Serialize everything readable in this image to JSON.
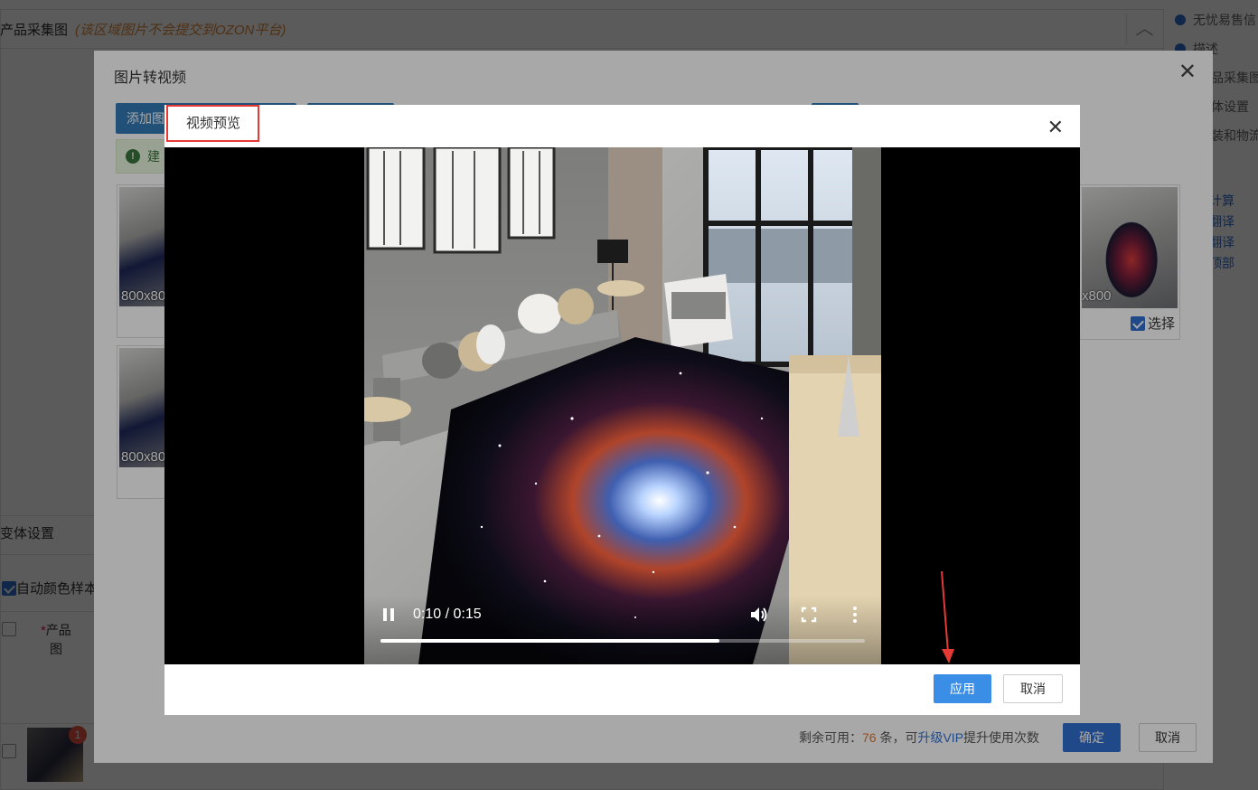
{
  "background": {
    "section_title": "产品采集图",
    "section_note": "(该区域图片不会提交到OZON平台)",
    "right_nav": [
      {
        "label": "无忧易售信",
        "active": true
      },
      {
        "label": "描述",
        "active": true
      },
      {
        "label": "品采集图",
        "active": false
      },
      {
        "label": "体设置",
        "active": false
      },
      {
        "label": "装和物流",
        "active": false
      }
    ],
    "right_links": [
      "计算",
      "翻译",
      "翻译",
      "顶部"
    ],
    "variants_title": "变体设置",
    "auto_color_label": "自动颜色样本",
    "product_image_col": "产品图",
    "row_badge": "1"
  },
  "outer_dialog": {
    "title": "图片转视频",
    "add_image_button": "添加图",
    "alert_text": "建",
    "image_cards": [
      {
        "size": "800x80"
      },
      {
        "size": "800x80"
      }
    ],
    "right_card": {
      "size": "x800",
      "select_label": "选择",
      "selected": true
    },
    "footer": {
      "remain_prefix": "剩余可用：",
      "remain_count": "76",
      "remain_middle": " 条，可",
      "upgrade_link": "升级VIP",
      "remain_suffix": "提升使用次数",
      "ok_label": "确定",
      "cancel_label": "取消"
    }
  },
  "video_dialog": {
    "title": "视频预览",
    "player": {
      "current_time": "0:10",
      "duration": "0:15",
      "time_text": "0:10 / 0:15",
      "progress": 0.7,
      "state": "playing"
    },
    "apply_label": "应用",
    "cancel_label": "取消"
  },
  "colors": {
    "primary": "#2f6fd1",
    "apply": "#3a8ee6",
    "highlight_box": "#e53935",
    "annotation_arrow": "#e53935",
    "note_orange": "#e08a3a"
  }
}
